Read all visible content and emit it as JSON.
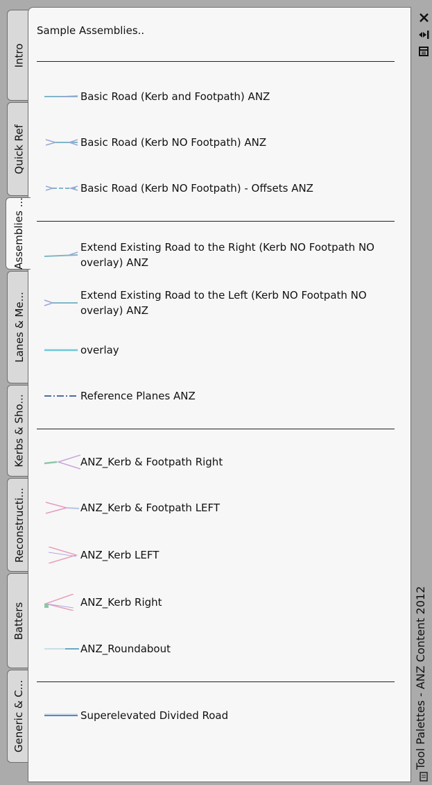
{
  "palette": {
    "title": "Tool Palettes - ANZ Content 2012",
    "heading": "Sample Assemblies..",
    "tabs": [
      "Intro",
      "Quick Ref",
      "Assemblies ...",
      "Lanes & Me...",
      "Kerbs & Sho...",
      "Reconstructi...",
      "Batters",
      "Generic & C..."
    ],
    "active_tab": "Assemblies ...",
    "tools": [
      {
        "label": "Basic Road (Kerb and Footpath) ANZ",
        "icon": "assembly-icon"
      },
      {
        "label": "Basic Road (Kerb NO Footpath) ANZ",
        "icon": "assembly-icon"
      },
      {
        "label": "Basic Road (Kerb NO Footpath) - Offsets ANZ",
        "icon": "assembly-icon"
      },
      {
        "label": "Extend Existing Road to the Right (Kerb NO Footpath NO overlay) ANZ",
        "icon": "assembly-icon"
      },
      {
        "label": "Extend Existing Road to the Left (Kerb NO Footpath NO overlay) ANZ",
        "icon": "assembly-icon"
      },
      {
        "label": "overlay",
        "icon": "assembly-icon"
      },
      {
        "label": "Reference Planes ANZ",
        "icon": "assembly-icon"
      },
      {
        "label": "ANZ_Kerb & Footpath Right",
        "icon": "subassembly-icon"
      },
      {
        "label": "ANZ_Kerb & Footpath LEFT",
        "icon": "subassembly-icon"
      },
      {
        "label": "ANZ_Kerb LEFT",
        "icon": "subassembly-icon"
      },
      {
        "label": "ANZ_Kerb Right",
        "icon": "subassembly-icon"
      },
      {
        "label": "ANZ_Roundabout",
        "icon": "assembly-icon"
      },
      {
        "label": "Superelevated Divided Road",
        "icon": "assembly-icon"
      }
    ]
  },
  "window_controls": [
    "close-icon",
    "auto-hide-icon",
    "properties-icon"
  ]
}
